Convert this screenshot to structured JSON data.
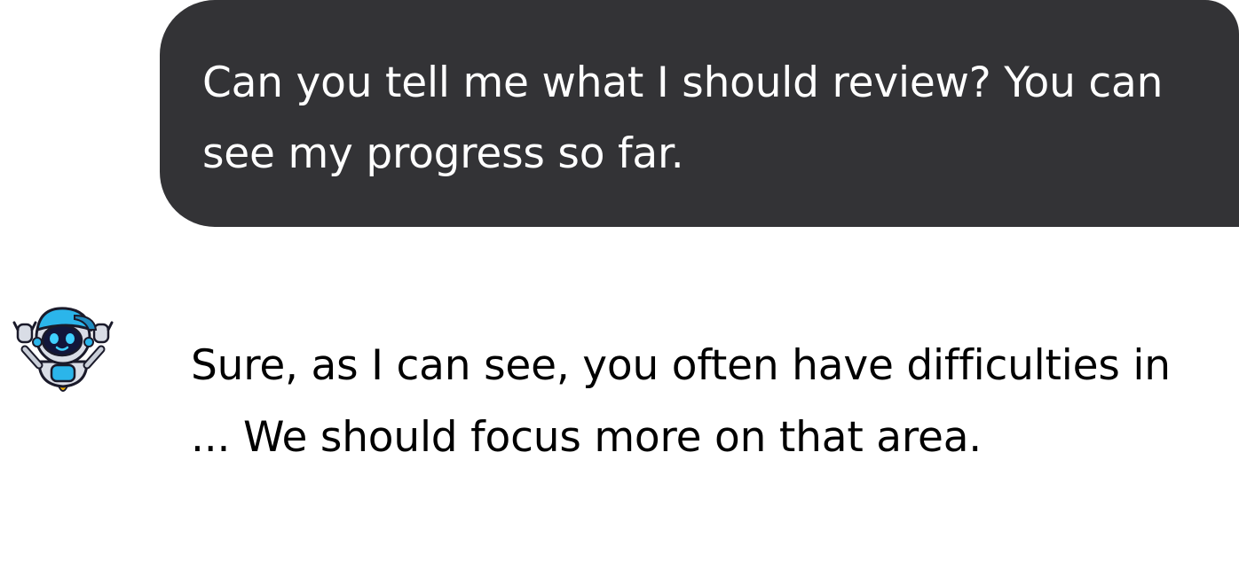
{
  "messages": {
    "user": {
      "text": "Can you tell me what I should review? You can see my progress so far."
    },
    "assistant": {
      "avatar_icon": "robot-mascot-icon",
      "text": "Sure, as I can see, you often have difficulties in ... We should focus more on that area."
    }
  },
  "colors": {
    "user_bubble_bg": "#333336",
    "user_text": "#ffffff",
    "assistant_text": "#000000",
    "robot_accent": "#2bb5ea"
  }
}
